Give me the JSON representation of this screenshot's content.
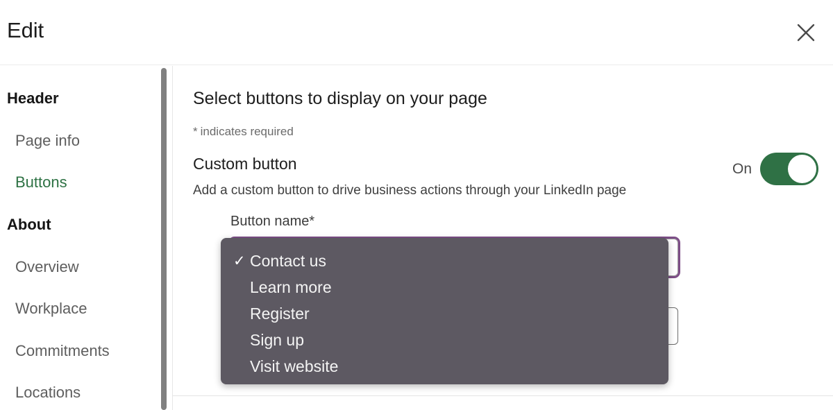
{
  "header": {
    "title": "Edit",
    "close_icon": "close-icon"
  },
  "sidebar": {
    "groups": [
      {
        "title": "Header",
        "items": [
          {
            "label": "Page info",
            "active": false
          },
          {
            "label": "Buttons",
            "active": true
          }
        ]
      },
      {
        "title": "About",
        "items": [
          {
            "label": "Overview",
            "active": false
          },
          {
            "label": "Workplace",
            "active": false
          },
          {
            "label": "Commitments",
            "active": false
          },
          {
            "label": "Locations",
            "active": false
          }
        ]
      }
    ]
  },
  "main": {
    "heading": "Select buttons to display on your page",
    "required_star": "*",
    "required_note": "indicates required",
    "section": {
      "title": "Custom button",
      "description": "Add a custom button to drive business actions through your LinkedIn page"
    },
    "toggle": {
      "label": "On",
      "state": "on",
      "color": "#2f7145"
    },
    "field": {
      "label": "Button name*",
      "selected_value": "Contact us"
    },
    "dropdown": {
      "options": [
        {
          "label": "Contact us",
          "selected": true
        },
        {
          "label": "Learn more",
          "selected": false
        },
        {
          "label": "Register",
          "selected": false
        },
        {
          "label": "Sign up",
          "selected": false
        },
        {
          "label": "Visit website",
          "selected": false
        }
      ],
      "check_glyph": "✓",
      "background": "#5d5962"
    }
  },
  "colors": {
    "accent_green": "#2e7244",
    "focus_purple": "#7d4e87",
    "text_dark": "#1d1d1d",
    "text_muted": "#5e5e5e"
  }
}
